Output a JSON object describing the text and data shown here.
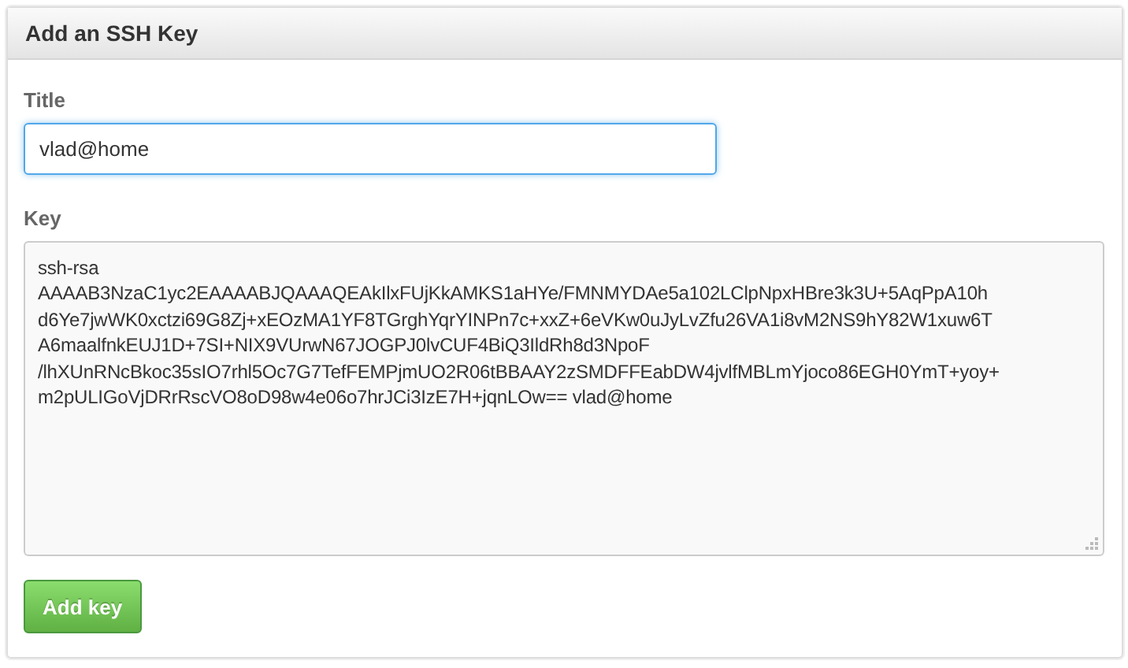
{
  "panel": {
    "title": "Add an SSH Key"
  },
  "title_field": {
    "label": "Title",
    "value": "vlad@home",
    "focused": true
  },
  "key_field": {
    "label": "Key",
    "value": "ssh-rsa\nAAAAB3NzaC1yc2EAAAABJQAAAQEAkIlxFUjKkAMKS1aHYe/FMNMYDAe5a102LClpNpxHBre3k3U+5AqPpA10h\nd6Ye7jwWK0xctzi69G8Zj+xEOzMA1YF8TGrghYqrYINPn7c+xxZ+6eVKw0uJyLvZfu26VA1i8vM2NS9hY82W1xuw6T\nA6maalfnkEUJ1D+7SI+NIX9VUrwN67JOGPJ0lvCUF4BiQ3IldRh8d3NpoF\n/lhXUnRNcBkoc35sIO7rhl5Oc7G7TefFEMPjmUO2R06tBBAAY2zSMDFFEabDW4jvlfMBLmYjoco86EGH0YmT+yoy+\nm2pULIGoVjDRrRscVO8oD98w4e06o7hrJCi3IzE7H+jqnLOw== vlad@home"
  },
  "submit_button": {
    "label": "Add key"
  }
}
